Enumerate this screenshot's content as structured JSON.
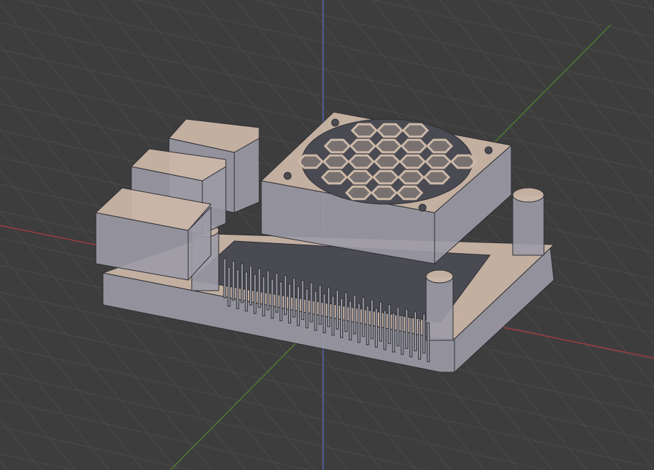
{
  "viewport": {
    "background": "#3d3d3d",
    "grid_color": "#4b4b4b",
    "axis_x_color": "#a03b3b",
    "axis_y_color": "#4f7a2d",
    "axis_z_color": "#5666b8"
  },
  "model": {
    "top_color": "#cdb9a8",
    "side_color": "#9c9ba6",
    "dark_color": "#4a4a52",
    "edge_color": "#2d2d33"
  }
}
